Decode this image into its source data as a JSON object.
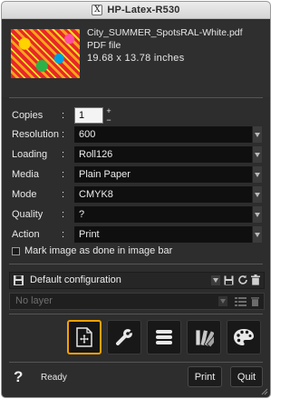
{
  "window": {
    "title": "HP-Latex-R530",
    "app_badge": "X"
  },
  "file": {
    "name": "City_SUMMER_SpotsRAL-White.pdf",
    "type": "PDF file",
    "size": "19.68 x 13.78 inches"
  },
  "settings": {
    "copies": {
      "label": "Copies",
      "value": "1"
    },
    "resolution": {
      "label": "Resolution",
      "value": "600"
    },
    "loading": {
      "label": "Loading",
      "value": "Roll126"
    },
    "media": {
      "label": "Media",
      "value": "Plain Paper"
    },
    "mode": {
      "label": "Mode",
      "value": "CMYK8"
    },
    "quality": {
      "label": "Quality",
      "value": "?"
    },
    "action": {
      "label": "Action",
      "value": "Print"
    },
    "separator": ":"
  },
  "mark_option": {
    "label": "Mark image as done in image bar",
    "checked": false
  },
  "configuration": {
    "value": "Default configuration"
  },
  "layer": {
    "placeholder": "No layer"
  },
  "toolbar": {
    "buttons": [
      {
        "icon": "page-move-icon",
        "active": true
      },
      {
        "icon": "wrench-icon",
        "active": false
      },
      {
        "icon": "list-icon",
        "active": false
      },
      {
        "icon": "swatch-fan-icon",
        "active": false
      },
      {
        "icon": "palette-icon",
        "active": false
      }
    ],
    "accent": "#f5a100"
  },
  "status": {
    "help_glyph": "?",
    "text": "Ready"
  },
  "buttons": {
    "print": "Print",
    "quit": "Quit"
  }
}
